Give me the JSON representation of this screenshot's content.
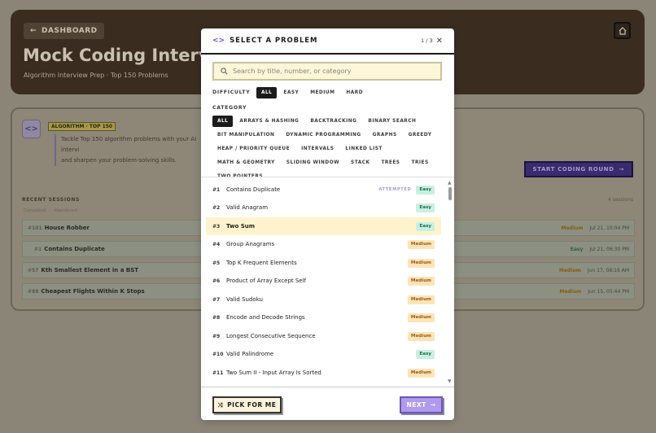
{
  "background": {
    "dashboard_label": "DASHBOARD",
    "hero_title": "Mock Coding Interv",
    "hero_subtitle": "Algorithm Interview Prep · Top 150 Problems",
    "algo_badge": "ALGORITHM · TOP 150",
    "algo_desc_1": "Tackle Top 150 algorithm problems with your AI intervi",
    "algo_desc_2": "and sharpen your problem-solving skills.",
    "start_label": "START CODING ROUND",
    "recent_label": "RECENT SESSIONS",
    "recent_count": "4 sessions",
    "filters": [
      "Completed",
      "Abandoned"
    ],
    "sessions": [
      {
        "num": "#101",
        "title": "House Robber",
        "difficulty": "Medium",
        "date": "Jul 21, 10:04 PM"
      },
      {
        "num": "#1",
        "title": "Contains Duplicate",
        "difficulty": "Easy",
        "date": "Jul 21, 06:30 PM"
      },
      {
        "num": "#57",
        "title": "Kth Smallest Element in a BST",
        "difficulty": "Medium",
        "date": "Jun 17, 08:16 AM"
      },
      {
        "num": "#88",
        "title": "Cheapest Flights Within K Stops",
        "difficulty": "Medium",
        "date": "Jun 15, 05:44 PM"
      }
    ]
  },
  "modal": {
    "title": "SELECT A PROBLEM",
    "page_indicator": "1 / 3",
    "search_placeholder": "Search by title, number, or category",
    "difficulty_label": "DIFFICULTY",
    "difficulty_options": [
      "ALL",
      "EASY",
      "MEDIUM",
      "HARD"
    ],
    "difficulty_selected": "ALL",
    "category_label": "CATEGORY",
    "categories": [
      "ALL",
      "ARRAYS & HASHING",
      "BACKTRACKING",
      "BINARY SEARCH",
      "BIT MANIPULATION",
      "DYNAMIC PROGRAMMING",
      "GRAPHS",
      "GREEDY",
      "HEAP / PRIORITY QUEUE",
      "INTERVALS",
      "LINKED LIST",
      "MATH & GEOMETRY",
      "SLIDING WINDOW",
      "STACK",
      "TREES",
      "TRIES",
      "TWO POINTERS"
    ],
    "category_selected": "ALL",
    "problems": [
      {
        "num": "#1",
        "title": "Contains Duplicate",
        "attempted": "ATTEMPTED",
        "difficulty": "Easy"
      },
      {
        "num": "#2",
        "title": "Valid Anagram",
        "attempted": "",
        "difficulty": "Easy"
      },
      {
        "num": "#3",
        "title": "Two Sum",
        "attempted": "",
        "difficulty": "Easy",
        "selected": true
      },
      {
        "num": "#4",
        "title": "Group Anagrams",
        "attempted": "",
        "difficulty": "Medium"
      },
      {
        "num": "#5",
        "title": "Top K Frequent Elements",
        "attempted": "",
        "difficulty": "Medium"
      },
      {
        "num": "#6",
        "title": "Product of Array Except Self",
        "attempted": "",
        "difficulty": "Medium"
      },
      {
        "num": "#7",
        "title": "Valid Sudoku",
        "attempted": "",
        "difficulty": "Medium"
      },
      {
        "num": "#8",
        "title": "Encode and Decode Strings",
        "attempted": "",
        "difficulty": "Medium"
      },
      {
        "num": "#9",
        "title": "Longest Consecutive Sequence",
        "attempted": "",
        "difficulty": "Medium"
      },
      {
        "num": "#10",
        "title": "Valid Palindrome",
        "attempted": "",
        "difficulty": "Easy"
      },
      {
        "num": "#11",
        "title": "Two Sum II - Input Array Is Sorted",
        "attempted": "",
        "difficulty": "Medium"
      }
    ],
    "pick_label": "PICK FOR ME",
    "next_label": "NEXT"
  },
  "colors": {
    "accent": "#7b4bd6",
    "selected_row": "#fef3cd",
    "easy_bg": "#c8f0e0",
    "medium_bg": "#fde4b8"
  }
}
